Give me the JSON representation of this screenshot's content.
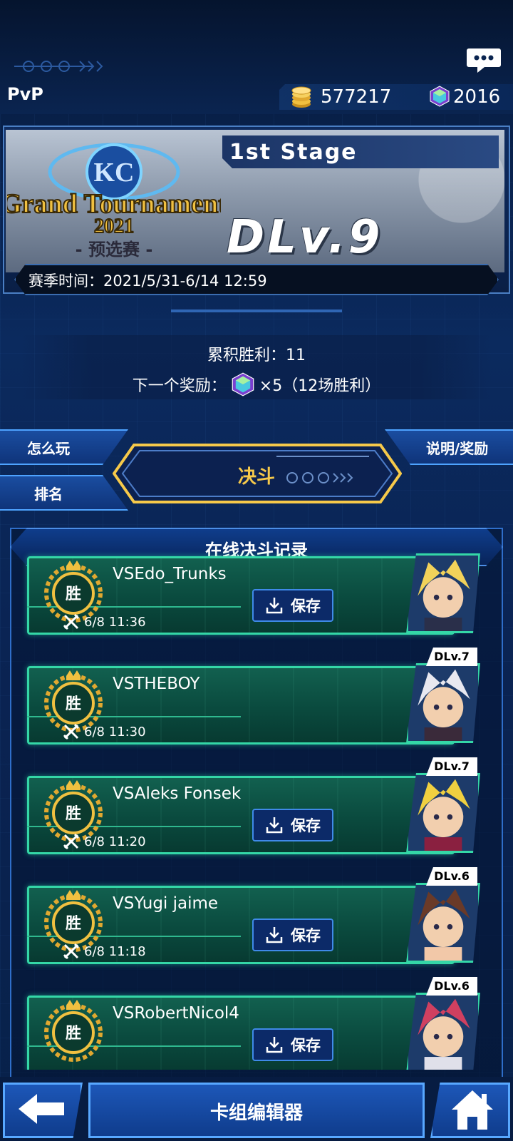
{
  "header": {
    "mode_label": "PvP",
    "gold": "577217",
    "gems": "2016"
  },
  "tournament": {
    "logo_top": "KC",
    "logo_name": "Grand Tournament",
    "logo_year": "2021",
    "logo_sub": "- 预选赛 -",
    "stage": "1st Stage",
    "dlv": "DLv.9",
    "season": "赛季时间：2021/5/31-6/14 12:59"
  },
  "progress": {
    "wins": "累积胜利：11",
    "next_reward_label": "下一个奖励：",
    "next_reward_value": "×5（12场胜利）"
  },
  "nav": {
    "how_to_play": "怎么玩",
    "ranking": "排名",
    "info_rewards": "说明/奖励",
    "duel": "决斗"
  },
  "records": {
    "title": "在线决斗记录",
    "win_char": "胜",
    "save_label": "保存",
    "items": [
      {
        "name": "VSEdo_Trunks",
        "time": "6/8 11:36",
        "dlv": "",
        "has_save": true
      },
      {
        "name": "VSTHEBOY",
        "time": "6/8 11:30",
        "dlv": "DLv.7",
        "has_save": false
      },
      {
        "name": "VSAleks Fonsek",
        "time": "6/8 11:20",
        "dlv": "DLv.7",
        "has_save": true
      },
      {
        "name": "VSYugi jaime",
        "time": "6/8 11:18",
        "dlv": "DLv.6",
        "has_save": true
      },
      {
        "name": "VSRobertNicol4",
        "time": "",
        "dlv": "DLv.6",
        "has_save": true
      }
    ]
  },
  "footer": {
    "deck_editor": "卡组编辑器"
  },
  "colors": {
    "accent": "#34d7a7",
    "gold_text": "#f6c94a",
    "bg": "#0b2a5e"
  },
  "icons": [
    "chat-icon",
    "coin-icon",
    "gem-icon",
    "back-arrow-icon",
    "home-icon",
    "download-icon",
    "crossed-swords-icon",
    "win-medal-icon"
  ]
}
